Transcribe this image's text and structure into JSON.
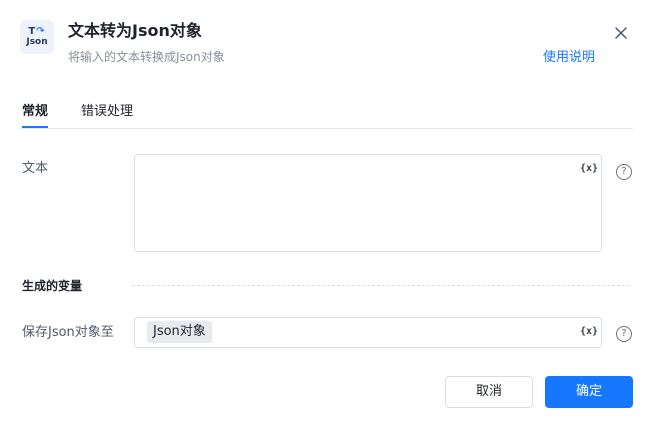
{
  "header": {
    "logo_top": "T",
    "logo_arrow": "↷",
    "logo_bottom": "Json",
    "title": "文本转为Json对象",
    "subtitle": "将输入的文本转换成Json对象",
    "help_link": "使用说明"
  },
  "tabs": [
    {
      "label": "常规",
      "active": true
    },
    {
      "label": "错误处理",
      "active": false
    }
  ],
  "form": {
    "text_label": "文本",
    "text_value": "",
    "variable_icon": "{x}",
    "help_icon": "?",
    "section_title": "生成的变量",
    "save_label": "保存Json对象至",
    "save_value": "Json对象"
  },
  "buttons": {
    "cancel": "取消",
    "ok": "确定"
  },
  "colors": {
    "accent": "#1677ff",
    "border": "#d9dde4",
    "tag_bg": "#e8eaed"
  }
}
